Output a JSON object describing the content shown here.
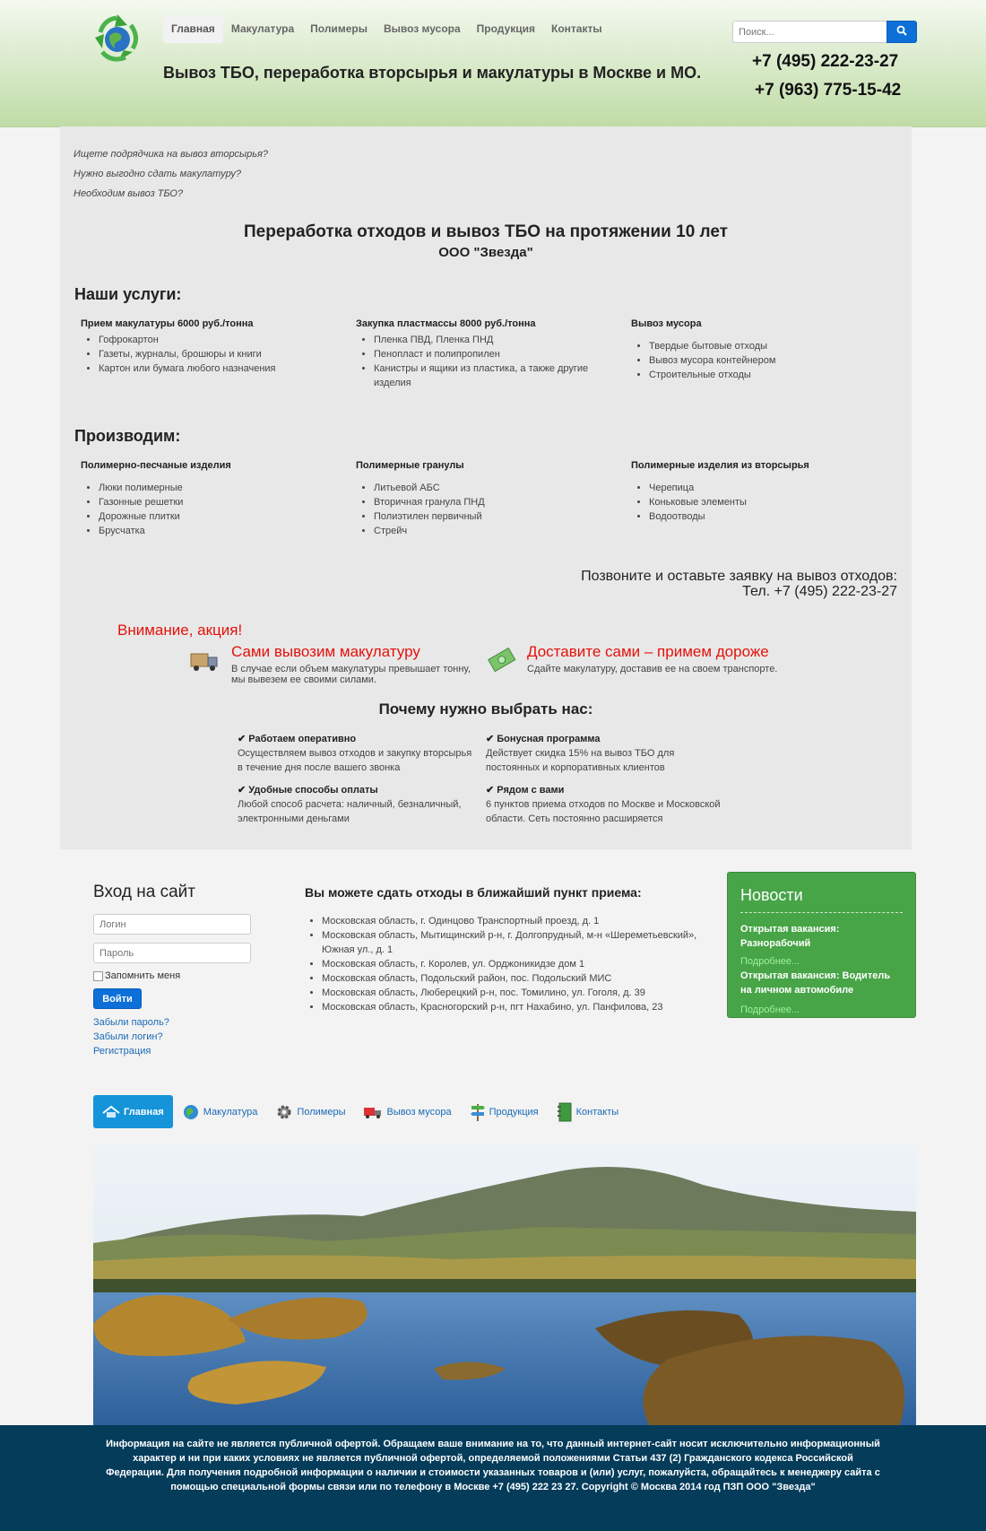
{
  "nav": {
    "items": [
      "Главная",
      "Макулатура",
      "Полимеры",
      "Вывоз мусора",
      "Продукция",
      "Контакты"
    ],
    "active": "Главная"
  },
  "search": {
    "placeholder": "Поиск..."
  },
  "header": {
    "tagline": "Вывоз ТБО, переработка вторсырья и макулатуры в Москве и МО.",
    "phone1": "+7 (495) 222-23-27",
    "phone2": "+7 (963) 775-15-42"
  },
  "intro": {
    "questions": [
      "Ищете подрядчика на вывоз вторсырья?",
      "Нужно выгодно сдать макулатуру?",
      "Необходим вывоз ТБО?"
    ],
    "title": "Переработка отходов и вывоз ТБО на протяжении 10 лет",
    "subtitle": "ООО \"Звезда\""
  },
  "services": {
    "heading": "Наши услуги:",
    "columns": [
      {
        "title": "Прием макулатуры 6000 руб./тонна",
        "items": [
          "Гофрокартон",
          "Газеты, журналы, брошюры и книги",
          "Картон или бумага любого назначения"
        ]
      },
      {
        "title": "Закупка пластмассы 8000 руб./тонна",
        "items": [
          "Пленка ПВД, Пленка ПНД",
          "Пенопласт и полипропилен",
          "Канистры и ящики из пластика, а также другие изделия"
        ]
      },
      {
        "title": "Вывоз мусора",
        "items": [
          "Твердые бытовые отходы",
          "Вывоз мусора контейнером",
          "Строительные отходы"
        ]
      }
    ]
  },
  "production": {
    "heading": "Производим:",
    "columns": [
      {
        "title": "Полимерно-песчаные изделия",
        "items": [
          "Люки полимерные",
          "Газонные решетки",
          "Дорожные плитки",
          "Брусчатка"
        ]
      },
      {
        "title": "Полимерные гранулы",
        "items": [
          "Литьевой АБС",
          "Вторичная гранула ПНД",
          "Полиэтилен первичный",
          "Стрейч"
        ]
      },
      {
        "title": "Полимерные изделия из вторсырья",
        "items": [
          "Черепица",
          "Коньковые элементы",
          "Водоотводы"
        ]
      }
    ]
  },
  "call": {
    "line1": "Позвоните и оставьте заявку на вывоз отходов:",
    "line2": "Тел. +7 (495) 222-23-27"
  },
  "promo": {
    "heading": "Внимание, акция!",
    "left": {
      "title": "Сами вывозим макулатуру",
      "text": "В случае если объем макулатуры превышает тонну, мы вывезем ее своими силами."
    },
    "right": {
      "title": "Доставите сами – примем дороже",
      "text": "Сдайте макулатуру, доставив ее на своем транспорте."
    }
  },
  "why": {
    "heading": "Почему нужно выбрать нас:",
    "features": [
      {
        "title": "✔ Работаем оперативно",
        "text": "Осуществляем вывоз отходов и закупку вторсырья в течение дня после вашего звонка"
      },
      {
        "title": "✔ Бонусная программа",
        "text": "Действует скидка 15% на вывоз ТБО для постоянных и корпоративных клиентов"
      },
      {
        "title": "✔ Удобные способы оплаты",
        "text": "Любой способ расчета: наличный, безналичный, электронными деньгами"
      },
      {
        "title": "✔ Рядом с вами",
        "text": "6 пунктов приема отходов по Москве и Московской области. Сеть постоянно расширяется"
      }
    ]
  },
  "login": {
    "heading": "Вход на сайт",
    "login_placeholder": "Логин",
    "password_placeholder": "Пароль",
    "remember": "Запомнить меня",
    "submit": "Войти",
    "forgot_password": "Забыли пароль?",
    "forgot_login": "Забыли логин?",
    "register": "Регистрация"
  },
  "points": {
    "heading": "Вы можете сдать отходы в ближайший пункт приема:",
    "items": [
      "Московская область, г. Одинцово Транспортный проезд, д. 1",
      "Московская область, Мытищинский р-н, г. Долгопрудный, м-н «Шереметьевский», Южная ул., д. 1",
      "Московская область, г. Королев, ул. Орджоникидзе дом 1",
      "Московская область, Подольский район, пос. Подольский МИС",
      "Московская область, Люберецкий р-н, пос. Томилино, ул. Гоголя, д. 39",
      "Московская область, Красногорский р-н, пгт Нахабино, ул. Панфилова, 23"
    ]
  },
  "news": {
    "heading": "Новости",
    "items": [
      {
        "title": "Открытая вакансия: Разнорабочий",
        "more": "Подробнее..."
      },
      {
        "title": "Открытая вакансия: Водитель на личном автомобиле",
        "more": "Подробнее..."
      }
    ]
  },
  "menu2": {
    "items": [
      {
        "label": "Главная",
        "icon": "home-icon"
      },
      {
        "label": "Макулатура",
        "icon": "globe-icon"
      },
      {
        "label": "Полимеры",
        "icon": "gear-icon"
      },
      {
        "label": "Вывоз мусора",
        "icon": "truck-icon"
      },
      {
        "label": "Продукция",
        "icon": "signpost-icon"
      },
      {
        "label": "Контакты",
        "icon": "notebook-icon"
      }
    ]
  },
  "footer": {
    "text": "Информация на сайте не является публичной офертой. Обращаем ваше внимание на то, что данный интернет-сайт носит исключительно информационный характер и ни при каких условиях не является публичной офертой, определяемой положениями Статьи 437 (2) Гражданского кодекса Российской Федерации. Для получения подробной информации о наличии и стоимости указанных товаров и (или) услуг, пожалуйста, обращайтесь к менеджеру сайта с помощью специальной формы связи или по телефону в Москве +7 (495) 222 23 27. Copyright © Москва 2014 год ПЗП ООО \"Звезда\""
  },
  "colors": {
    "accent": "#0d6fd8",
    "promo_red": "#e3120b",
    "news_green": "#47a447",
    "footer_bg": "#043c5a",
    "menu_active": "#1594d9"
  }
}
